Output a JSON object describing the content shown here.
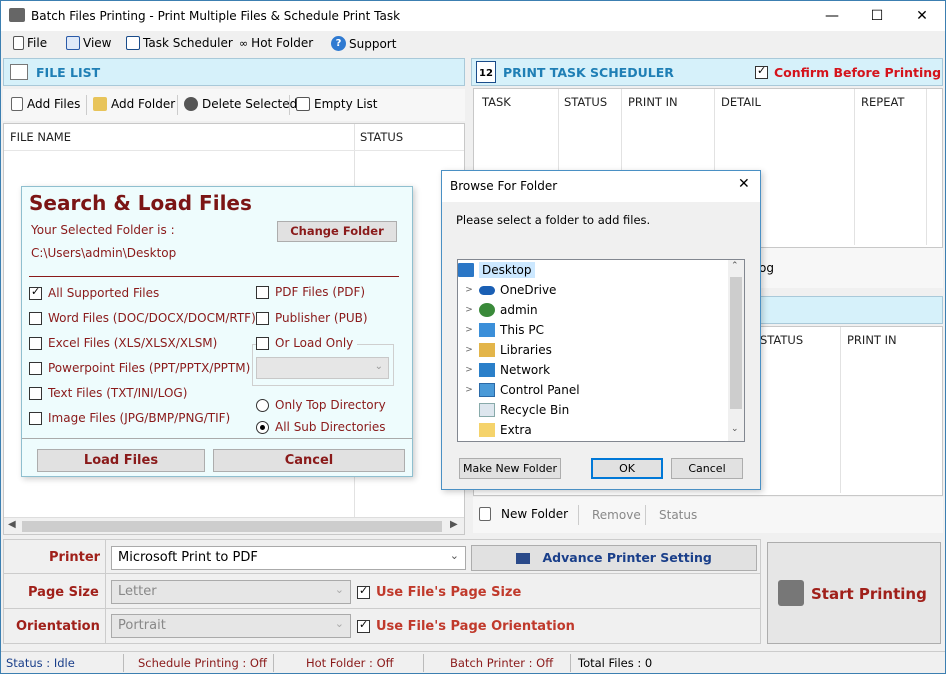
{
  "window": {
    "title": "Batch Files Printing - Print Multiple Files & Schedule Print Task",
    "minimize": "—",
    "maximize": "☐",
    "close": "✕"
  },
  "menu": {
    "items": [
      {
        "label": "File",
        "icon": "file-icon"
      },
      {
        "label": "View",
        "icon": "view-icon"
      },
      {
        "label": "Task Scheduler",
        "icon": "calendar-icon"
      },
      {
        "label": "Hot Folder",
        "icon": "glasses-icon"
      },
      {
        "label": "Support",
        "icon": "help-icon"
      }
    ]
  },
  "file_list": {
    "title": "FILE LIST",
    "toolbar": {
      "add_files": "Add Files",
      "add_folder": "Add Folder",
      "delete_selected": "Delete Selected",
      "empty_list": "Empty List"
    },
    "columns": [
      "FILE NAME",
      "STATUS"
    ]
  },
  "scheduler": {
    "title": "PRINT TASK SCHEDULER",
    "day_number": "12",
    "confirm_label": "Confirm Before Printing",
    "confirm_checked": true,
    "columns": [
      "TASK",
      "STATUS",
      "PRINT IN",
      "DETAIL",
      "REPEAT"
    ],
    "hidden_button_fragment": "og"
  },
  "hot_folder": {
    "columns": [
      "STATUS",
      "PRINT IN"
    ],
    "new_folder": "New Folder",
    "remove": "Remove",
    "status": "Status"
  },
  "search_dialog": {
    "title": "Search & Load Files",
    "selected_folder_label": "Your Selected Folder is :",
    "folder_path": "C:\\Users\\admin\\Desktop",
    "change_folder": "Change Folder",
    "left_options": [
      {
        "label": "All Supported Files",
        "checked": true
      },
      {
        "label": "Word Files (DOC/DOCX/DOCM/RTF)",
        "checked": false
      },
      {
        "label": "Excel Files (XLS/XLSX/XLSM)",
        "checked": false
      },
      {
        "label": "Powerpoint Files (PPT/PPTX/PPTM)",
        "checked": false
      },
      {
        "label": "Text Files (TXT/INI/LOG)",
        "checked": false
      },
      {
        "label": "Image Files (JPG/BMP/PNG/TIF)",
        "checked": false
      }
    ],
    "right_options": [
      {
        "label": "PDF Files (PDF)",
        "checked": false
      },
      {
        "label": "Publisher (PUB)",
        "checked": false
      }
    ],
    "or_load_only": "Or Load Only",
    "only_top_directory": "Only Top Directory",
    "all_sub_directories": "All Sub Directories",
    "selected_directory_mode": "All Sub Directories",
    "load_files": "Load Files",
    "cancel": "Cancel"
  },
  "browse_dialog": {
    "title": "Browse For Folder",
    "instruction": "Please select a folder to add files.",
    "tree": [
      {
        "label": "Desktop",
        "icon": "desktop-icon",
        "selected": true,
        "expandable": false
      },
      {
        "label": "OneDrive",
        "icon": "cloud-icon",
        "selected": false,
        "expandable": true
      },
      {
        "label": "admin",
        "icon": "user-icon",
        "selected": false,
        "expandable": true
      },
      {
        "label": "This PC",
        "icon": "computer-icon",
        "selected": false,
        "expandable": true
      },
      {
        "label": "Libraries",
        "icon": "library-icon",
        "selected": false,
        "expandable": true
      },
      {
        "label": "Network",
        "icon": "network-icon",
        "selected": false,
        "expandable": true
      },
      {
        "label": "Control Panel",
        "icon": "control-panel-icon",
        "selected": false,
        "expandable": true
      },
      {
        "label": "Recycle Bin",
        "icon": "recycle-bin-icon",
        "selected": false,
        "expandable": false
      },
      {
        "label": "Extra",
        "icon": "folder-icon",
        "selected": false,
        "expandable": false
      }
    ],
    "make_new_folder": "Make New Folder",
    "ok": "OK",
    "cancel": "Cancel"
  },
  "printer_settings": {
    "printer_label": "Printer",
    "printer_value": "Microsoft Print to PDF",
    "advance_setting": "Advance Printer Setting",
    "page_size_label": "Page Size",
    "page_size_value": "Letter",
    "use_page_size": "Use File's Page Size",
    "orientation_label": "Orientation",
    "orientation_value": "Portrait",
    "use_orientation": "Use File's Page Orientation",
    "start_printing": "Start Printing"
  },
  "status_bar": {
    "status": "Status :  Idle",
    "schedule": "Schedule Printing : Off",
    "hot_folder": "Hot Folder : Off",
    "batch_printer": "Batch Printer : Off",
    "total_files": "Total Files :  0"
  },
  "colors": {
    "accent": "#1f7fb5",
    "label_red": "#a0201a",
    "panel_header": "#d6f1fa",
    "confirm_red": "#d4141c"
  }
}
